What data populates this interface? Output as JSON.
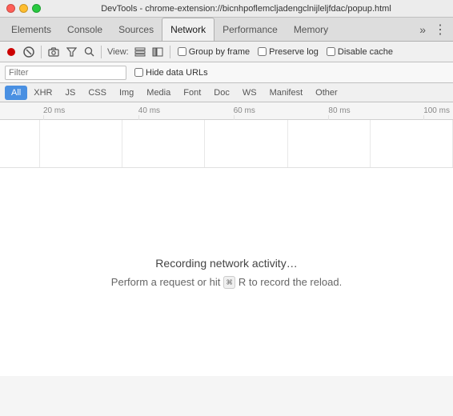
{
  "titleBar": {
    "title": "DevTools - chrome-extension://bicnhpoflemcljadengclnijleljfdac/popup.html"
  },
  "mainTabs": {
    "items": [
      {
        "label": "Elements",
        "active": false
      },
      {
        "label": "Console",
        "active": false
      },
      {
        "label": "Sources",
        "active": false
      },
      {
        "label": "Network",
        "active": true
      },
      {
        "label": "Performance",
        "active": false
      },
      {
        "label": "Memory",
        "active": false
      }
    ],
    "more_label": "»",
    "kebab_label": "⋮"
  },
  "toolbar": {
    "view_label": "View:",
    "group_by_frame_label": "Group by frame",
    "preserve_log_label": "Preserve log",
    "disable_cache_label": "Disable cache"
  },
  "filterBar": {
    "filter_placeholder": "Filter",
    "hide_data_urls_label": "Hide data URLs"
  },
  "typeTabs": {
    "items": [
      {
        "label": "All",
        "active": true
      },
      {
        "label": "XHR",
        "active": false
      },
      {
        "label": "JS",
        "active": false
      },
      {
        "label": "CSS",
        "active": false
      },
      {
        "label": "Img",
        "active": false
      },
      {
        "label": "Media",
        "active": false
      },
      {
        "label": "Font",
        "active": false
      },
      {
        "label": "Doc",
        "active": false
      },
      {
        "label": "WS",
        "active": false
      },
      {
        "label": "Manifest",
        "active": false
      },
      {
        "label": "Other",
        "active": false
      }
    ]
  },
  "timeline": {
    "ticks": [
      "20 ms",
      "40 ms",
      "60 ms",
      "80 ms",
      "100 ms"
    ]
  },
  "emptyState": {
    "message": "Recording network activity…",
    "hint_prefix": "Perform a request or hit ",
    "hint_cmd": "⌘",
    "hint_key": "R",
    "hint_suffix": " to record the reload."
  }
}
